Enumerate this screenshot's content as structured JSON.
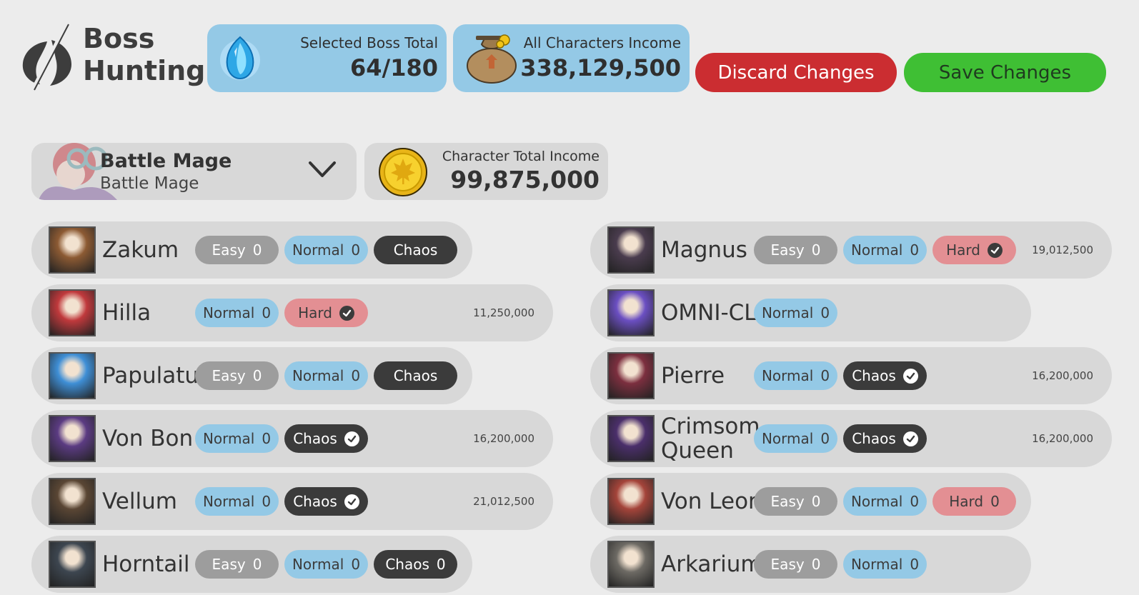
{
  "header": {
    "title_line1": "Boss",
    "title_line2": "Hunting",
    "selected_boss_label": "Selected Boss Total",
    "selected_boss_value": "64/180",
    "all_income_label": "All Characters Income",
    "all_income_value": "338,129,500",
    "discard_label": "Discard Changes",
    "save_label": "Save Changes"
  },
  "character": {
    "name": "Battle Mage",
    "class": "Battle Mage",
    "income_label": "Character Total Income",
    "income_value": "99,875,000"
  },
  "bosses_left": [
    {
      "name": "Zakum",
      "income": "",
      "art": "#8c5a33",
      "difficulties": [
        {
          "type": "easy",
          "label": "Easy",
          "count": "0",
          "selected": false
        },
        {
          "type": "normal",
          "label": "Normal",
          "count": "0",
          "selected": false
        },
        {
          "type": "chaos",
          "label": "Chaos",
          "count": "",
          "selected": false
        }
      ]
    },
    {
      "name": "Hilla",
      "income": "11,250,000",
      "art": "#c0393c",
      "difficulties": [
        {
          "type": "normal",
          "label": "Normal",
          "count": "0",
          "selected": false
        },
        {
          "type": "hard",
          "label": "Hard",
          "count": "",
          "selected": true
        }
      ]
    },
    {
      "name": "Papulatus",
      "income": "",
      "art": "#3f8fd6",
      "difficulties": [
        {
          "type": "easy",
          "label": "Easy",
          "count": "0",
          "selected": false
        },
        {
          "type": "normal",
          "label": "Normal",
          "count": "0",
          "selected": false
        },
        {
          "type": "chaos",
          "label": "Chaos",
          "count": "",
          "selected": false
        }
      ]
    },
    {
      "name": "Von Bon",
      "income": "16,200,000",
      "art": "#5b3b82",
      "difficulties": [
        {
          "type": "normal",
          "label": "Normal",
          "count": "0",
          "selected": false
        },
        {
          "type": "chaos",
          "label": "Chaos",
          "count": "",
          "selected": true
        }
      ]
    },
    {
      "name": "Vellum",
      "income": "21,012,500",
      "art": "#5a4634",
      "difficulties": [
        {
          "type": "normal",
          "label": "Normal",
          "count": "0",
          "selected": false
        },
        {
          "type": "chaos",
          "label": "Chaos",
          "count": "",
          "selected": true
        }
      ]
    },
    {
      "name": "Horntail",
      "income": "",
      "art": "#3d4650",
      "difficulties": [
        {
          "type": "easy",
          "label": "Easy",
          "count": "0",
          "selected": false
        },
        {
          "type": "normal",
          "label": "Normal",
          "count": "0",
          "selected": false
        },
        {
          "type": "chaos",
          "label": "Chaos",
          "count": "0",
          "selected": false
        }
      ]
    }
  ],
  "bosses_right": [
    {
      "name": "Magnus",
      "income": "19,012,500",
      "art": "#4a3c4e",
      "difficulties": [
        {
          "type": "easy",
          "label": "Easy",
          "count": "0",
          "selected": false
        },
        {
          "type": "normal",
          "label": "Normal",
          "count": "0",
          "selected": false
        },
        {
          "type": "hard",
          "label": "Hard",
          "count": "",
          "selected": true
        }
      ]
    },
    {
      "name": "OMNI-CLN",
      "income": "",
      "art": "#6b4fc2",
      "difficulties": [
        {
          "type": "normal",
          "label": "Normal",
          "count": "0",
          "selected": false
        }
      ]
    },
    {
      "name": "Pierre",
      "income": "16,200,000",
      "art": "#7c2f3f",
      "difficulties": [
        {
          "type": "normal",
          "label": "Normal",
          "count": "0",
          "selected": false
        },
        {
          "type": "chaos",
          "label": "Chaos",
          "count": "",
          "selected": true
        }
      ]
    },
    {
      "name": "Crimsom Queen",
      "income": "16,200,000",
      "art": "#4b2f6b",
      "difficulties": [
        {
          "type": "normal",
          "label": "Normal",
          "count": "0",
          "selected": false
        },
        {
          "type": "chaos",
          "label": "Chaos",
          "count": "",
          "selected": true
        }
      ]
    },
    {
      "name": "Von Leon",
      "income": "",
      "art": "#a4443a",
      "difficulties": [
        {
          "type": "easy",
          "label": "Easy",
          "count": "0",
          "selected": false
        },
        {
          "type": "normal",
          "label": "Normal",
          "count": "0",
          "selected": false
        },
        {
          "type": "hard",
          "label": "Hard",
          "count": "0",
          "selected": false
        }
      ]
    },
    {
      "name": "Arkarium",
      "income": "",
      "art": "#6d6a64",
      "difficulties": [
        {
          "type": "easy",
          "label": "Easy",
          "count": "0",
          "selected": false
        },
        {
          "type": "normal",
          "label": "Normal",
          "count": "0",
          "selected": false
        }
      ]
    }
  ],
  "icons": {
    "logo": "boss-logo-icon",
    "boss_total": "blue-crystal-icon",
    "income": "money-bag-icon",
    "coin": "maple-coin-icon",
    "dropdown": "chevron-down-icon",
    "selected": "check-icon"
  },
  "colors": {
    "background": "#ececec",
    "card": "#d8d8d8",
    "easy": "#9d9d9d",
    "normal": "#94c9e6",
    "hard": "#e38f93",
    "chaos": "#3b3b3b",
    "discard": "#cb2d31",
    "save": "#3fbf34"
  }
}
